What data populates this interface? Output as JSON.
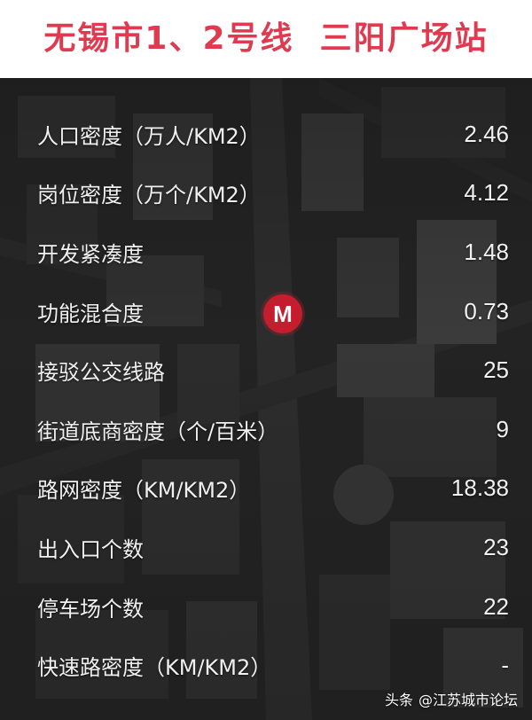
{
  "header": {
    "title": "无锡市1、2号线  三阳广场站"
  },
  "metro_marker": {
    "label": "M",
    "icon": "metro-m-icon",
    "color": "#c41e2e"
  },
  "metrics": [
    {
      "label": "人口密度（万人/KM2）",
      "value": "2.46"
    },
    {
      "label": "岗位密度（万个/KM2）",
      "value": "4.12"
    },
    {
      "label": "开发紧凑度",
      "value": "1.48"
    },
    {
      "label": "功能混合度",
      "value": "0.73"
    },
    {
      "label": "接驳公交线路",
      "value": "25"
    },
    {
      "label": "街道底商密度（个/百米）",
      "value": "9"
    },
    {
      "label": "路网密度（KM/KM2）",
      "value": "18.38"
    },
    {
      "label": "出入口个数",
      "value": "23"
    },
    {
      "label": "停车场个数",
      "value": "22"
    },
    {
      "label": "快速路密度（KM/KM2）",
      "value": "-"
    }
  ],
  "watermark": {
    "brand": "头条",
    "account": "@江苏城市论坛"
  },
  "colors": {
    "title": "#e03a50",
    "background_dark": "#272727",
    "text": "#f0f0f0"
  }
}
